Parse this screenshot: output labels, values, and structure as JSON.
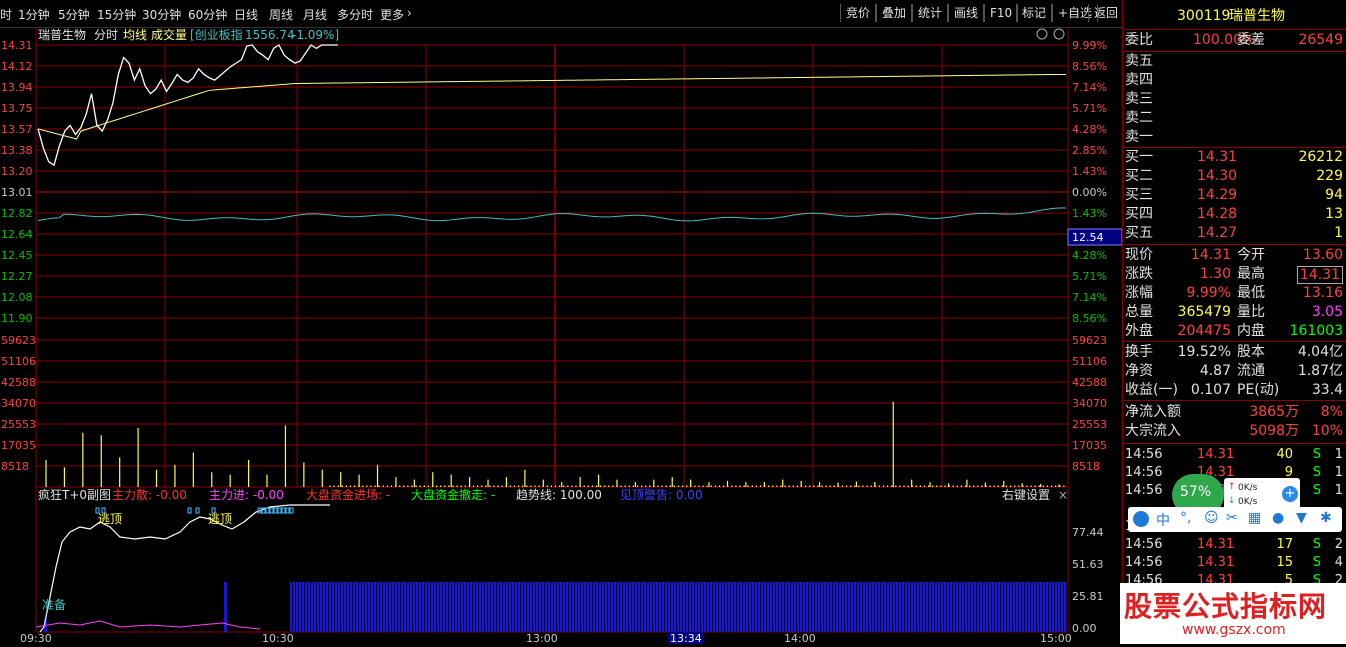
{
  "toolbar": {
    "periods": [
      "时",
      "1分钟",
      "5分钟",
      "15分钟",
      "30分钟",
      "60分钟",
      "日线",
      "周线",
      "月线",
      "多分时",
      "更多"
    ],
    "more_arrow": "›",
    "buttons": [
      "竞价",
      "叠加",
      "统计",
      "画线",
      "F10",
      "标记",
      "+自选",
      "返回"
    ]
  },
  "price_chart": {
    "stock_name": "瑞普生物",
    "labels": [
      "分时",
      "均线",
      "成交量"
    ],
    "index_name": "[创业板指",
    "index_value": "1556.74",
    "index_change": "-1.09%]",
    "left_prices": [
      "14.31",
      "14.12",
      "13.94",
      "13.75",
      "13.57",
      "13.38",
      "13.20",
      "13.01",
      "12.82",
      "12.64",
      "12.45",
      "12.27",
      "12.08",
      "11.90"
    ],
    "right_pcts": [
      "9.99%",
      "8.56%",
      "7.14%",
      "5.71%",
      "4.28%",
      "2.85%",
      "1.43%",
      "0.00%",
      "1.43%",
      "",
      "4.28%",
      "5.71%",
      "7.14%",
      "8.56%"
    ],
    "cursor_price": "12.54",
    "colors": {
      "up": "#ff4040",
      "down": "#00c000",
      "flat": "#c8c8c8",
      "grid": "#8b0000",
      "price_line": "#ffffff",
      "avg_line": "#ffff80",
      "index_line": "#40c0c0"
    }
  },
  "volume_chart": {
    "left_ticks": [
      "59623",
      "51106",
      "42588",
      "34070",
      "25553",
      "17035",
      "8518"
    ],
    "right_ticks": [
      "59623",
      "51106",
      "42588",
      "34070",
      "25553",
      "17035",
      "8518"
    ]
  },
  "indicator_panel": {
    "title": "疯狂T+0副图",
    "items": [
      {
        "label": "主力散",
        "value": "-0.00",
        "color": "#ff3030"
      },
      {
        "label": "主力进",
        "value": "-0.00",
        "color": "#ff40ff"
      },
      {
        "label": "大盘资金进场",
        "value": "-",
        "color": "#ff3030"
      },
      {
        "label": "大盘资金撤走",
        "value": "-",
        "color": "#00ff00"
      },
      {
        "label": "趋势线",
        "value": "100.00",
        "color": "#e0e0e0"
      },
      {
        "label": "见顶警告",
        "value": "0.00",
        "color": "#4040ff"
      }
    ],
    "right_label": "右键设置",
    "close": "×",
    "right_ticks": [
      "77.44",
      "51.63",
      "25.81",
      "0.00"
    ],
    "annotations": {
      "escape_top": "逃顶",
      "prepare": "准备"
    }
  },
  "time_axis": {
    "labels": [
      "09:30",
      "10:30",
      "13:00",
      "14:00",
      "15:00"
    ],
    "cursor_time": "13:34"
  },
  "quote_panel": {
    "code": "300119",
    "name": "瑞普生物",
    "weibi_label": "委比",
    "weibi_value": "100.00%",
    "weicha_label": "委差",
    "weicha_value": "26549",
    "sell_levels": [
      "卖五",
      "卖四",
      "卖三",
      "卖二",
      "卖一"
    ],
    "buy_levels": [
      {
        "label": "买一",
        "price": "14.31",
        "vol": "26212"
      },
      {
        "label": "买二",
        "price": "14.30",
        "vol": "229"
      },
      {
        "label": "买三",
        "price": "14.29",
        "vol": "94"
      },
      {
        "label": "买四",
        "price": "14.28",
        "vol": "13"
      },
      {
        "label": "买五",
        "price": "14.27",
        "vol": "1"
      }
    ],
    "stats": [
      {
        "l1": "现价",
        "v1": "14.31",
        "c1": "#ff4040",
        "l2": "今开",
        "v2": "13.60",
        "c2": "#ff4040"
      },
      {
        "l1": "涨跌",
        "v1": "1.30",
        "c1": "#ff4040",
        "l2": "最高",
        "v2": "14.31",
        "c2": "#ff4040"
      },
      {
        "l1": "涨幅",
        "v1": "9.99%",
        "c1": "#ff4040",
        "l2": "最低",
        "v2": "13.16",
        "c2": "#ff4040"
      },
      {
        "l1": "总量",
        "v1": "365479",
        "c1": "#ffff40",
        "l2": "量比",
        "v2": "3.05",
        "c2": "#ff40ff"
      },
      {
        "l1": "外盘",
        "v1": "204475",
        "c1": "#ff4040",
        "l2": "内盘",
        "v2": "161003",
        "c2": "#00ff00"
      }
    ],
    "fund": [
      {
        "l1": "换手",
        "v1": "19.52%",
        "l2": "股本",
        "v2": "4.04亿"
      },
      {
        "l1": "净资",
        "v1": "4.87",
        "l2": "流通",
        "v2": "1.87亿"
      },
      {
        "l1": "收益(一)",
        "v1": "0.107",
        "l2": "PE(动)",
        "v2": "33.4"
      }
    ],
    "flows": [
      {
        "label": "净流入额",
        "value": "3865万",
        "pct": "8%"
      },
      {
        "label": "大宗流入",
        "value": "5098万",
        "pct": "10%"
      }
    ],
    "ticks": [
      {
        "time": "14:56",
        "price": "14.31",
        "vol": "40",
        "bs": "S",
        "n": "1"
      },
      {
        "time": "14:56",
        "price": "14.31",
        "vol": "9",
        "bs": "S",
        "n": "1"
      },
      {
        "time": "14:56",
        "price": "14.31",
        "vol": "",
        "bs": "S",
        "n": "1"
      },
      {
        "time": "14:56",
        "price": "14.31",
        "vol": "",
        "bs": "S",
        "n": "1"
      },
      {
        "time": "14:56",
        "price": "14.31",
        "vol": "17",
        "bs": "S",
        "n": "2"
      },
      {
        "time": "14:56",
        "price": "14.31",
        "vol": "15",
        "bs": "S",
        "n": "4"
      },
      {
        "time": "14:56",
        "price": "14.31",
        "vol": "5",
        "bs": "S",
        "n": "2"
      }
    ]
  },
  "overlays": {
    "speed_pct": "57%",
    "up_speed": "0K/s",
    "down_speed": "0K/s",
    "ime_label": "中",
    "banner_title": "股票公式指标网",
    "banner_url": "www.gszx.com"
  }
}
